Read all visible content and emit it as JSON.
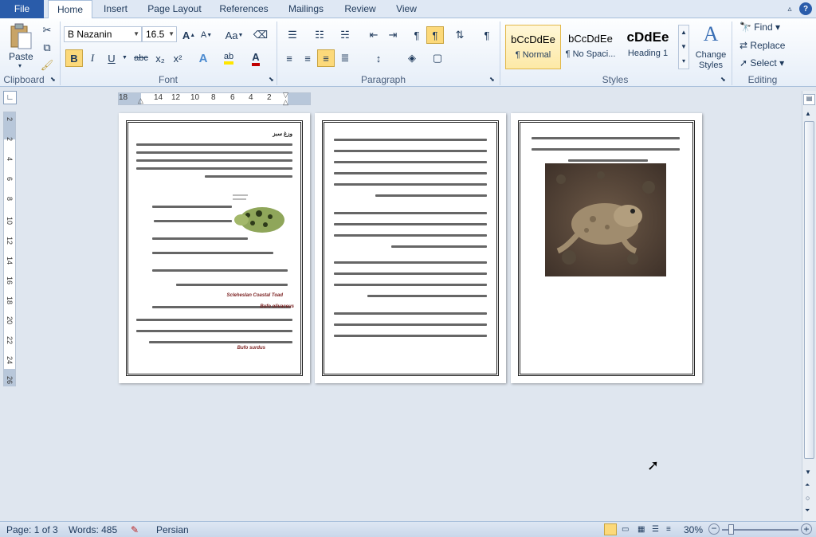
{
  "tabs": [
    "File",
    "Home",
    "Insert",
    "Page Layout",
    "References",
    "Mailings",
    "Review",
    "View"
  ],
  "ribbon": {
    "clipboard": {
      "paste": "Paste",
      "label": "Clipboard"
    },
    "font": {
      "name": "B Nazanin",
      "size": "16.5",
      "label": "Font",
      "bold": "B",
      "italic": "I",
      "underline": "U",
      "strike": "abc",
      "sub": "x₂",
      "sup": "x²",
      "grow": "A",
      "shrink": "A",
      "case": "Aa"
    },
    "paragraph": {
      "label": "Paragraph"
    },
    "styles": {
      "label": "Styles",
      "items": [
        {
          "preview": "bCcDdEe",
          "name": "¶ Normal"
        },
        {
          "preview": "bCcDdEe",
          "name": "¶ No Spaci..."
        },
        {
          "preview": "cDdEe",
          "name": "Heading 1"
        }
      ],
      "change": "Change Styles"
    },
    "editing": {
      "label": "Editing",
      "find": "Find",
      "replace": "Replace",
      "select": "Select"
    }
  },
  "ruler": {
    "ticks": [
      "18",
      "14",
      "12",
      "10",
      "8",
      "6",
      "4",
      "2"
    ]
  },
  "vruler": {
    "ticks": [
      "2",
      "2",
      "4",
      "6",
      "8",
      "10",
      "12",
      "14",
      "16",
      "18",
      "20",
      "22",
      "24",
      "26"
    ]
  },
  "pages": {
    "p1": {
      "title": "وزغ سبز",
      "sci1": "Scleheslan Coastal Toad",
      "sci2": "Bufo olivaceus",
      "sci3": "Bufo surdus"
    },
    "p3": {
      "caption": "گونه‌ای از وزغ"
    }
  },
  "status": {
    "page": "Page: 1 of 3",
    "words": "Words: 485",
    "language": "Persian",
    "zoom": "30%"
  },
  "colors": {
    "file_tab": "#2a5caa",
    "ribbon_border": "#a8bfdb",
    "highlight": "#ffd966",
    "font_red": "#c00000"
  }
}
